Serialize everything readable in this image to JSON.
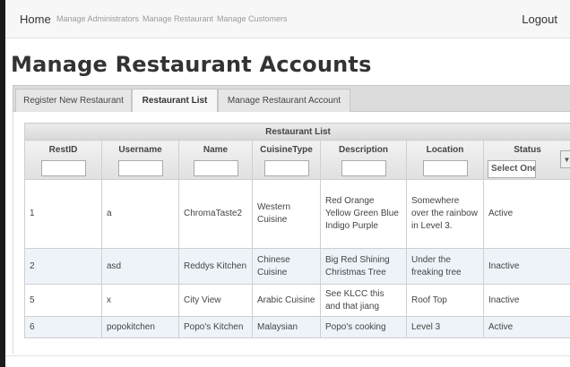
{
  "nav": {
    "home": "Home",
    "links": [
      "Manage Administrators",
      "Manage Restaurant",
      "Manage Customers"
    ],
    "logout": "Logout"
  },
  "page_title": "Manage Restaurant Accounts",
  "tabs": [
    {
      "label": "Register New Restaurant",
      "active": false
    },
    {
      "label": "Restaurant List",
      "active": true
    },
    {
      "label": "Manage Restaurant Account",
      "active": false
    }
  ],
  "table": {
    "caption": "Restaurant List",
    "columns": [
      "RestID",
      "Username",
      "Name",
      "CuisineType",
      "Description",
      "Location",
      "Status"
    ],
    "status_filter_value": "Select One...",
    "rows": [
      {
        "restid": "1",
        "username": "a",
        "name": "ChromaTaste2",
        "cuisine": "Western Cuisine",
        "description": "Red Orange Yellow Green Blue Indigo Purple",
        "location": "Somewhere over the rainbow in Level 3.",
        "status": "Active"
      },
      {
        "restid": "2",
        "username": "asd",
        "name": "Reddys Kitchen",
        "cuisine": "Chinese Cuisine",
        "description": "Big Red Shining Christmas Tree",
        "location": "Under the freaking tree",
        "status": "Inactive"
      },
      {
        "restid": "5",
        "username": "x",
        "name": "City View",
        "cuisine": "Arabic Cuisine",
        "description": "See KLCC this and that jiang",
        "location": "Roof Top",
        "status": "Inactive"
      },
      {
        "restid": "6",
        "username": "popokitchen",
        "name": "Popo's Kitchen",
        "cuisine": "Malaysian",
        "description": "Popo's cooking",
        "location": "Level 3",
        "status": "Active"
      }
    ]
  },
  "colors": {
    "tab_bar": "#dcdcdc",
    "alt_row": "#eef3f9",
    "grid_border": "#cfcfcf"
  }
}
